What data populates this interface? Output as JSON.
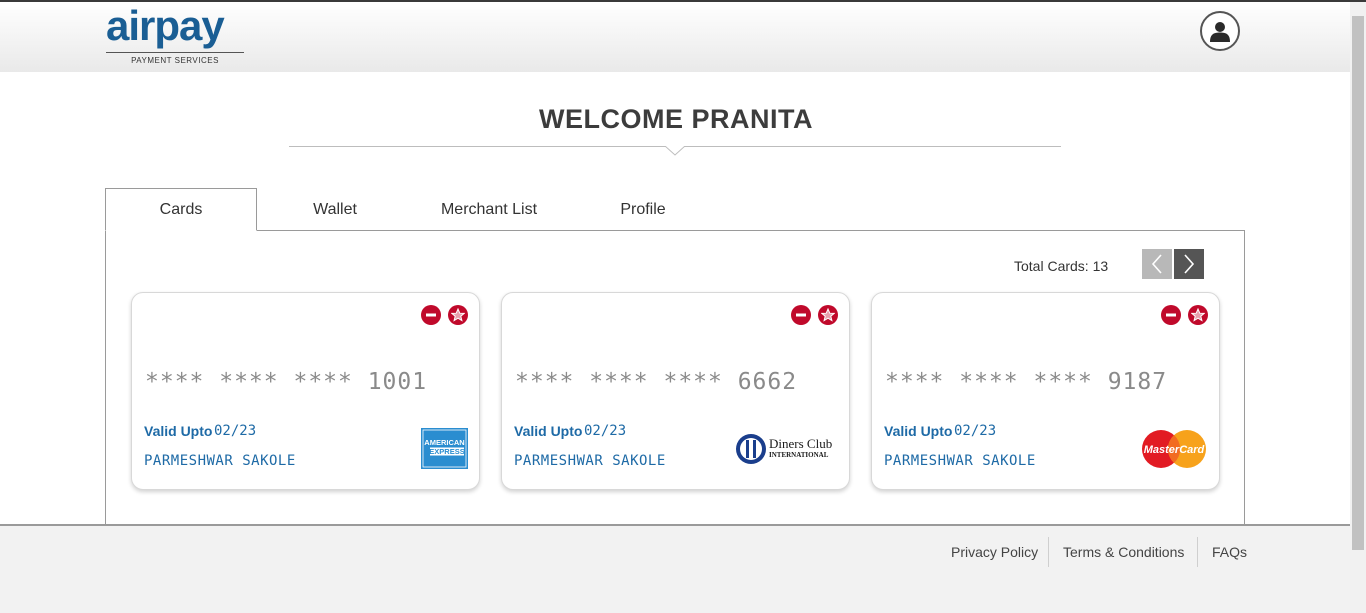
{
  "header": {
    "logo_text": "airpay",
    "logo_subtitle": "PAYMENT SERVICES",
    "user_icon": "user-icon"
  },
  "welcome": {
    "title": "WELCOME PRANITA"
  },
  "tabs": [
    {
      "label": "Cards",
      "active": true
    },
    {
      "label": "Wallet",
      "active": false
    },
    {
      "label": "Merchant List",
      "active": false
    },
    {
      "label": "Profile",
      "active": false
    }
  ],
  "cards_panel": {
    "total_label": "Total Cards: 13",
    "prev_icon": "chevron-left-icon",
    "next_icon": "chevron-right-icon"
  },
  "cards": [
    {
      "number": "**** **** **** 1001",
      "valid_label": "Valid Upto",
      "valid_value": "02/23",
      "holder": "PARMESHWAR SAKOLE",
      "brand": "AMERICAN EXPRESS"
    },
    {
      "number": "**** **** **** 6662",
      "valid_label": "Valid Upto",
      "valid_value": "02/23",
      "holder": "PARMESHWAR SAKOLE",
      "brand": "Diners Club INTERNATIONAL"
    },
    {
      "number": "**** **** **** 9187",
      "valid_label": "Valid Upto",
      "valid_value": "02/23",
      "holder": "PARMESHWAR SAKOLE",
      "brand": "MasterCard"
    }
  ],
  "brand_text": {
    "amex_1": "AMERICAN",
    "amex_2": "EXPRESS",
    "diners_1": "Diners Club",
    "diners_2": "INTERNATIONAL",
    "mc": "MasterCard"
  },
  "footer": {
    "links": [
      "Privacy Policy",
      "Terms & Conditions",
      "FAQs"
    ]
  },
  "colors": {
    "brand_blue": "#1a5e94",
    "action_red": "#c0092b",
    "card_text_blue": "#1e6aa6"
  }
}
